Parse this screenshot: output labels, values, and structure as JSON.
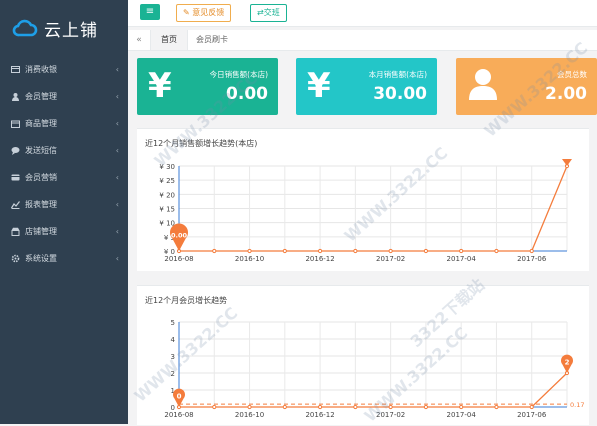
{
  "app": {
    "brand": "云上铺"
  },
  "sidebar": {
    "items": [
      {
        "label": "消费收银",
        "icon": "cashier-icon"
      },
      {
        "label": "会员管理",
        "icon": "user-icon"
      },
      {
        "label": "商品管理",
        "icon": "box-icon"
      },
      {
        "label": "发送短信",
        "icon": "comment-icon"
      },
      {
        "label": "会员营销",
        "icon": "card-icon"
      },
      {
        "label": "报表管理",
        "icon": "line-chart-icon"
      },
      {
        "label": "店铺管理",
        "icon": "store-icon"
      },
      {
        "label": "系统设置",
        "icon": "gear-icon"
      }
    ]
  },
  "toolbar": {
    "feedback_label": "意见反馈",
    "shift_label": "交班"
  },
  "tabs": [
    {
      "label": "首页"
    },
    {
      "label": "会员刷卡"
    }
  ],
  "cards": [
    {
      "title": "今日销售额(本店)",
      "value": "0.00",
      "color": "#1ab394",
      "icon": "yen-icon"
    },
    {
      "title": "本月销售额(本店)",
      "value": "30.00",
      "color": "#23c6c8",
      "icon": "yen-icon"
    },
    {
      "title": "会员总数",
      "value": "2.00",
      "color": "#f8ac59",
      "icon": "user-icon"
    }
  ],
  "watermark": "WWW.3322.CC",
  "watermark_alt": "3322下载站",
  "chart_data": [
    {
      "type": "line",
      "title": "近12个月销售额增长趋势(本店)",
      "x": [
        "2016-08",
        "2016-09",
        "2016-10",
        "2016-11",
        "2016-12",
        "2017-01",
        "2017-02",
        "2017-03",
        "2017-04",
        "2017-05",
        "2017-06",
        "2017-07"
      ],
      "xticks": [
        "2016-08",
        "2016-10",
        "2016-12",
        "2017-02",
        "2017-04",
        "2017-06"
      ],
      "yticks": [
        "¥ 0",
        "¥ 5",
        "¥ 10",
        "¥ 15",
        "¥ 20",
        "¥ 25",
        "¥ 30"
      ],
      "ylim": [
        0,
        30
      ],
      "series": [
        {
          "values": [
            0,
            0,
            0,
            0,
            0,
            0,
            0,
            0,
            0,
            0,
            0,
            30
          ]
        }
      ],
      "markers": [
        {
          "label": "0.00",
          "index": 0
        }
      ],
      "line_color": "#f47c3c",
      "grid": true
    },
    {
      "type": "line",
      "title": "近12个月会员增长趋势",
      "x": [
        "2016-08",
        "2016-09",
        "2016-10",
        "2016-11",
        "2016-12",
        "2017-01",
        "2017-02",
        "2017-03",
        "2017-04",
        "2017-05",
        "2017-06",
        "2017-07"
      ],
      "xticks": [
        "2016-08",
        "2016-10",
        "2016-12",
        "2017-02",
        "2017-04",
        "2017-06"
      ],
      "yticks": [
        "0",
        "1",
        "2",
        "3",
        "4",
        "5"
      ],
      "ylim": [
        0,
        5
      ],
      "series": [
        {
          "values": [
            0,
            0,
            0,
            0,
            0,
            0,
            0,
            0,
            0,
            0,
            0,
            2
          ]
        }
      ],
      "markers": [
        {
          "label": "0",
          "index": 0
        },
        {
          "label": "2",
          "index": 11
        }
      ],
      "average_line": {
        "label": "0.17",
        "value": 0.17
      },
      "line_color": "#f47c3c",
      "grid": true
    }
  ]
}
